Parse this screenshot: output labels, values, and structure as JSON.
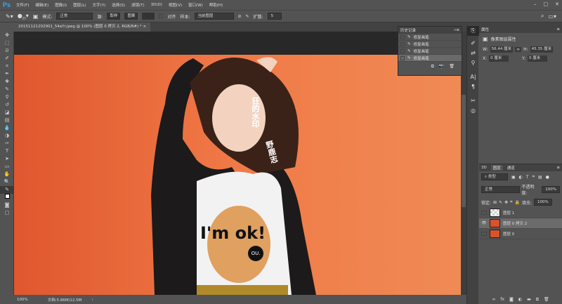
{
  "app": {
    "logo": "Ps",
    "menus": [
      "文件(F)",
      "编辑(E)",
      "图像(I)",
      "图层(L)",
      "文字(Y)",
      "选择(S)",
      "滤镜(T)",
      "3D(D)",
      "视图(V)",
      "窗口(W)",
      "帮助(H)"
    ],
    "window_controls": [
      "–",
      "□",
      "✕"
    ]
  },
  "options": {
    "brush_size": "25",
    "mode_label": "模式:",
    "mode_value": "正常",
    "source_label": "源:",
    "source_sampled": "取样",
    "source_pattern": "图案",
    "aligned_label": "对齐",
    "sample_label": "样本:",
    "sample_value": "当前图层",
    "diffusion_label": "扩散:",
    "diffusion_value": "5"
  },
  "document": {
    "tab_title": "20151121202901_54aYr.jpeg @ 100% (图层 0 拷贝 2, RGB/8#) *",
    "watermark_line1": "狂的水印",
    "watermark_line2": "野鹿志",
    "shirt_text": "I'm ok!",
    "badge_text": "OU."
  },
  "status": {
    "zoom": "100%",
    "doc_info": "文档:5.86M/12.5M"
  },
  "history": {
    "title": "历史记录",
    "items": [
      "修复画笔",
      "修复画笔",
      "修复画笔",
      "修复画笔"
    ]
  },
  "properties": {
    "title": "属性",
    "subtitle": "像素图层属性",
    "w_label": "W:",
    "w_value": "56.44 厘米",
    "h_label": "H:",
    "h_value": "45.35 厘米",
    "x_label": "X:",
    "x_value": "0 厘米",
    "y_label": "Y:",
    "y_value": "0 厘米"
  },
  "layers": {
    "tabs": [
      "3D",
      "图层",
      "通道"
    ],
    "filter": "类型",
    "blend": "正常",
    "opacity_label": "不透明度:",
    "opacity": "100%",
    "lock_label": "锁定:",
    "fill_label": "填充:",
    "fill": "100%",
    "items": [
      {
        "name": "图层 1",
        "visible": false
      },
      {
        "name": "图层 0 拷贝 2",
        "visible": true
      },
      {
        "name": "图层 0",
        "visible": false
      }
    ]
  }
}
